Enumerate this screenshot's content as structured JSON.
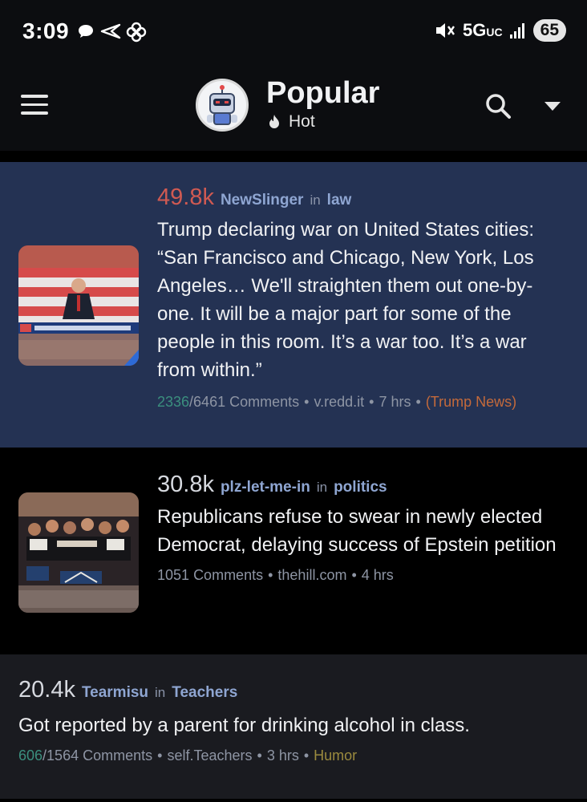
{
  "status_bar": {
    "time": "3:09",
    "network": "5G",
    "network_suffix": "UC",
    "battery": "65"
  },
  "header": {
    "title": "Popular",
    "sort_label": "Hot",
    "icons": [
      "menu-icon",
      "search-icon",
      "chevron-down-icon",
      "flame-icon"
    ]
  },
  "posts": [
    {
      "score": "49.8k",
      "score_color": "#d05a52",
      "author": "NewSlinger",
      "in_word": "in",
      "subreddit": "law",
      "title": "Trump declaring war on United States cities: “San Francisco and Chicago, New York, Los Angeles… We'll straighten them out one-by-one. It will be a major part for some of the people in this room. It’s a war too. It’s a war from within.”",
      "new_comments": "2336",
      "total_comments": "/6461",
      "comments_label": "Comments",
      "domain": "v.redd.it",
      "age": "7 hrs",
      "flair": "(Trump News)"
    },
    {
      "score": "30.8k",
      "score_color": "#d6d9df",
      "author": "plz-let-me-in",
      "in_word": "in",
      "subreddit": "politics",
      "title": "Republicans refuse to swear in newly elected Democrat, delaying success of Epstein petition",
      "comments": "1051",
      "comments_label": "Comments",
      "domain": "thehill.com",
      "age": "4 hrs"
    },
    {
      "score": "20.4k",
      "score_color": "#d6d9df",
      "author": "Tearmisu",
      "in_word": "in",
      "subreddit": "Teachers",
      "title": "Got reported by a parent for drinking alcohol in class.",
      "new_comments": "606",
      "total_comments": "/1564",
      "comments_label": "Comments",
      "domain": "self.Teachers",
      "age": "3 hrs",
      "flair": "Humor"
    }
  ],
  "dot": "•"
}
